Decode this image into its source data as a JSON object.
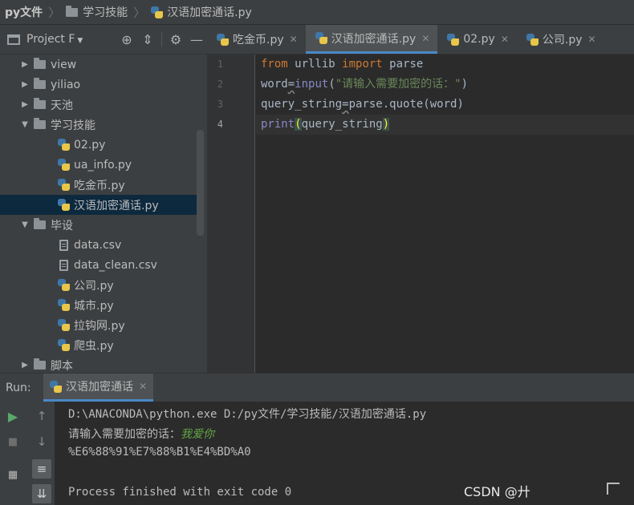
{
  "breadcrumb": [
    {
      "label": "py文件",
      "bold": true,
      "icon": "folder-icon"
    },
    {
      "label": "学习技能",
      "bold": false,
      "icon": "folder-icon"
    },
    {
      "label": "汉语加密通话.py",
      "bold": false,
      "icon": "python-file-icon"
    }
  ],
  "project_panel": {
    "title": "Project",
    "title_suffix": "F",
    "tools": [
      "target-icon",
      "collapse-icon",
      "gear-icon",
      "minimize-icon"
    ]
  },
  "tree": [
    {
      "label": "view",
      "type": "folder",
      "level": 0,
      "expanded": false
    },
    {
      "label": "yiliao",
      "type": "folder",
      "level": 0,
      "expanded": false
    },
    {
      "label": "天池",
      "type": "folder",
      "level": 0,
      "expanded": false
    },
    {
      "label": "学习技能",
      "type": "folder",
      "level": 0,
      "expanded": true
    },
    {
      "label": "02.py",
      "type": "py",
      "level": 1
    },
    {
      "label": "ua_info.py",
      "type": "py",
      "level": 1
    },
    {
      "label": "吃金币.py",
      "type": "py",
      "level": 1
    },
    {
      "label": "汉语加密通话.py",
      "type": "py",
      "level": 1,
      "selected": true
    },
    {
      "label": "毕设",
      "type": "folder",
      "level": 0,
      "expanded": true
    },
    {
      "label": "data.csv",
      "type": "csv",
      "level": 1
    },
    {
      "label": "data_clean.csv",
      "type": "csv",
      "level": 1
    },
    {
      "label": "公司.py",
      "type": "py",
      "level": 1
    },
    {
      "label": "城市.py",
      "type": "py",
      "level": 1
    },
    {
      "label": "拉钩网.py",
      "type": "py",
      "level": 1
    },
    {
      "label": "爬虫.py",
      "type": "py",
      "level": 1
    },
    {
      "label": "脚本",
      "type": "folder",
      "level": 0,
      "expanded": false
    }
  ],
  "editor_tabs": [
    {
      "label": "吃金币.py",
      "active": false
    },
    {
      "label": "汉语加密通话.py",
      "active": true
    },
    {
      "label": "02.py",
      "active": false
    },
    {
      "label": "公司.py",
      "active": false
    }
  ],
  "line_numbers": [
    "1",
    "2",
    "3",
    "4"
  ],
  "code": {
    "l1_kw_from": "from",
    "l1_module": " urllib ",
    "l1_kw_import": "import",
    "l1_name": " parse",
    "l2_var": "word",
    "l2_eq": "=",
    "l2_fn": "input",
    "l2_open": "(",
    "l2_str": "\"请输入需要加密的话：\"",
    "l2_close": ")",
    "l3_var": "query_string",
    "l3_eq": "=",
    "l3_rest": "parse.quote(word)",
    "l4_fn": "print",
    "l4_open": "(",
    "l4_arg": "query_string",
    "l4_close": ")"
  },
  "run_panel": {
    "label": "Run:",
    "tab_label": "汉语加密通话"
  },
  "console": {
    "command": "D:\\ANACONDA\\python.exe D:/py文件/学习技能/汉语加密通话.py",
    "prompt": "请输入需要加密的话：",
    "user_input": "我爱你",
    "output": "%E6%88%91%E7%88%B1%E4%BD%A0",
    "exit_message": "Process finished with exit code 0"
  },
  "watermark": "CSDN @廾"
}
